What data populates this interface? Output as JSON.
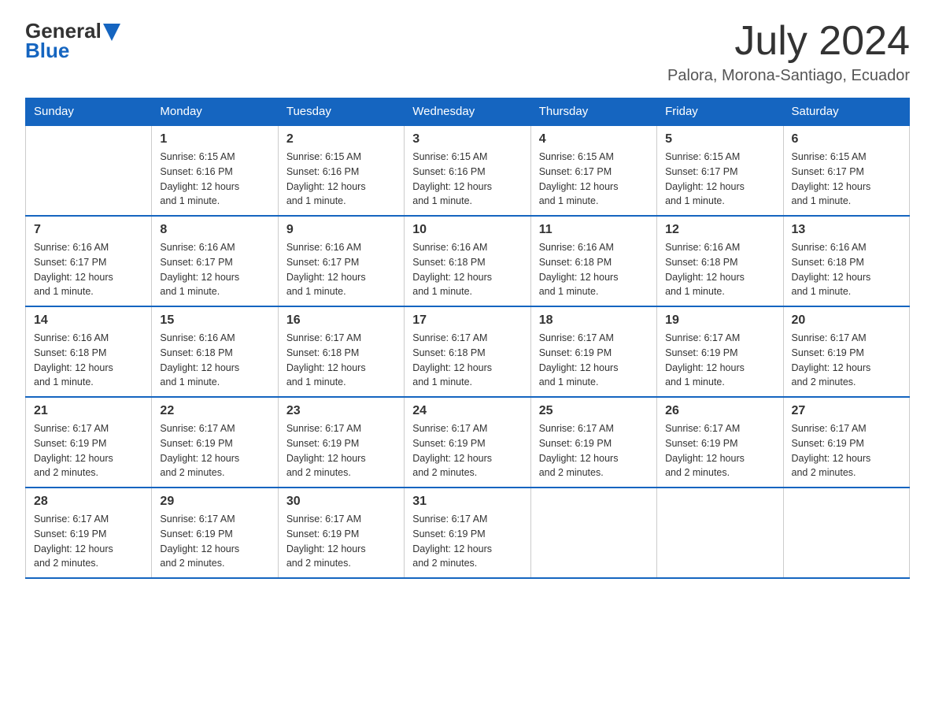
{
  "header": {
    "logo_general": "General",
    "logo_blue": "Blue",
    "month": "July 2024",
    "location": "Palora, Morona-Santiago, Ecuador"
  },
  "weekdays": [
    "Sunday",
    "Monday",
    "Tuesday",
    "Wednesday",
    "Thursday",
    "Friday",
    "Saturday"
  ],
  "weeks": [
    [
      {
        "day": "",
        "info": ""
      },
      {
        "day": "1",
        "info": "Sunrise: 6:15 AM\nSunset: 6:16 PM\nDaylight: 12 hours\nand 1 minute."
      },
      {
        "day": "2",
        "info": "Sunrise: 6:15 AM\nSunset: 6:16 PM\nDaylight: 12 hours\nand 1 minute."
      },
      {
        "day": "3",
        "info": "Sunrise: 6:15 AM\nSunset: 6:16 PM\nDaylight: 12 hours\nand 1 minute."
      },
      {
        "day": "4",
        "info": "Sunrise: 6:15 AM\nSunset: 6:17 PM\nDaylight: 12 hours\nand 1 minute."
      },
      {
        "day": "5",
        "info": "Sunrise: 6:15 AM\nSunset: 6:17 PM\nDaylight: 12 hours\nand 1 minute."
      },
      {
        "day": "6",
        "info": "Sunrise: 6:15 AM\nSunset: 6:17 PM\nDaylight: 12 hours\nand 1 minute."
      }
    ],
    [
      {
        "day": "7",
        "info": "Sunrise: 6:16 AM\nSunset: 6:17 PM\nDaylight: 12 hours\nand 1 minute."
      },
      {
        "day": "8",
        "info": "Sunrise: 6:16 AM\nSunset: 6:17 PM\nDaylight: 12 hours\nand 1 minute."
      },
      {
        "day": "9",
        "info": "Sunrise: 6:16 AM\nSunset: 6:17 PM\nDaylight: 12 hours\nand 1 minute."
      },
      {
        "day": "10",
        "info": "Sunrise: 6:16 AM\nSunset: 6:18 PM\nDaylight: 12 hours\nand 1 minute."
      },
      {
        "day": "11",
        "info": "Sunrise: 6:16 AM\nSunset: 6:18 PM\nDaylight: 12 hours\nand 1 minute."
      },
      {
        "day": "12",
        "info": "Sunrise: 6:16 AM\nSunset: 6:18 PM\nDaylight: 12 hours\nand 1 minute."
      },
      {
        "day": "13",
        "info": "Sunrise: 6:16 AM\nSunset: 6:18 PM\nDaylight: 12 hours\nand 1 minute."
      }
    ],
    [
      {
        "day": "14",
        "info": "Sunrise: 6:16 AM\nSunset: 6:18 PM\nDaylight: 12 hours\nand 1 minute."
      },
      {
        "day": "15",
        "info": "Sunrise: 6:16 AM\nSunset: 6:18 PM\nDaylight: 12 hours\nand 1 minute."
      },
      {
        "day": "16",
        "info": "Sunrise: 6:17 AM\nSunset: 6:18 PM\nDaylight: 12 hours\nand 1 minute."
      },
      {
        "day": "17",
        "info": "Sunrise: 6:17 AM\nSunset: 6:18 PM\nDaylight: 12 hours\nand 1 minute."
      },
      {
        "day": "18",
        "info": "Sunrise: 6:17 AM\nSunset: 6:19 PM\nDaylight: 12 hours\nand 1 minute."
      },
      {
        "day": "19",
        "info": "Sunrise: 6:17 AM\nSunset: 6:19 PM\nDaylight: 12 hours\nand 1 minute."
      },
      {
        "day": "20",
        "info": "Sunrise: 6:17 AM\nSunset: 6:19 PM\nDaylight: 12 hours\nand 2 minutes."
      }
    ],
    [
      {
        "day": "21",
        "info": "Sunrise: 6:17 AM\nSunset: 6:19 PM\nDaylight: 12 hours\nand 2 minutes."
      },
      {
        "day": "22",
        "info": "Sunrise: 6:17 AM\nSunset: 6:19 PM\nDaylight: 12 hours\nand 2 minutes."
      },
      {
        "day": "23",
        "info": "Sunrise: 6:17 AM\nSunset: 6:19 PM\nDaylight: 12 hours\nand 2 minutes."
      },
      {
        "day": "24",
        "info": "Sunrise: 6:17 AM\nSunset: 6:19 PM\nDaylight: 12 hours\nand 2 minutes."
      },
      {
        "day": "25",
        "info": "Sunrise: 6:17 AM\nSunset: 6:19 PM\nDaylight: 12 hours\nand 2 minutes."
      },
      {
        "day": "26",
        "info": "Sunrise: 6:17 AM\nSunset: 6:19 PM\nDaylight: 12 hours\nand 2 minutes."
      },
      {
        "day": "27",
        "info": "Sunrise: 6:17 AM\nSunset: 6:19 PM\nDaylight: 12 hours\nand 2 minutes."
      }
    ],
    [
      {
        "day": "28",
        "info": "Sunrise: 6:17 AM\nSunset: 6:19 PM\nDaylight: 12 hours\nand 2 minutes."
      },
      {
        "day": "29",
        "info": "Sunrise: 6:17 AM\nSunset: 6:19 PM\nDaylight: 12 hours\nand 2 minutes."
      },
      {
        "day": "30",
        "info": "Sunrise: 6:17 AM\nSunset: 6:19 PM\nDaylight: 12 hours\nand 2 minutes."
      },
      {
        "day": "31",
        "info": "Sunrise: 6:17 AM\nSunset: 6:19 PM\nDaylight: 12 hours\nand 2 minutes."
      },
      {
        "day": "",
        "info": ""
      },
      {
        "day": "",
        "info": ""
      },
      {
        "day": "",
        "info": ""
      }
    ]
  ]
}
